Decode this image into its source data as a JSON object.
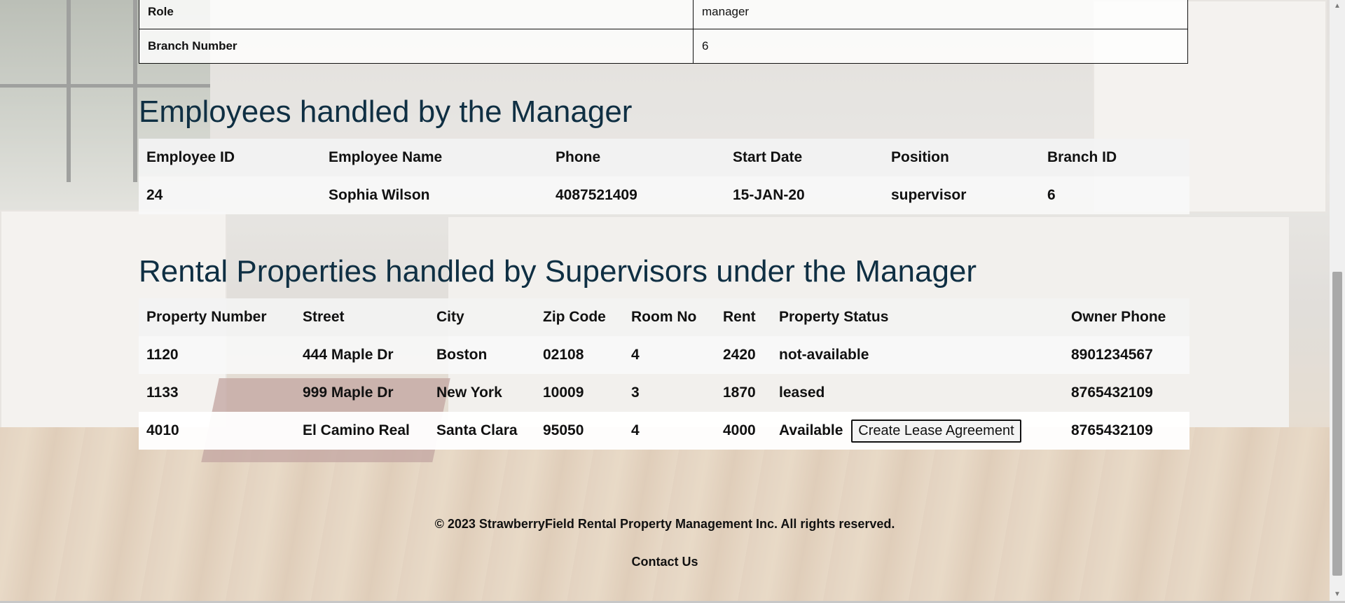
{
  "details": {
    "rows": [
      {
        "label": "Role",
        "value": "manager"
      },
      {
        "label": "Branch Number",
        "value": "6"
      }
    ]
  },
  "employees": {
    "heading": "Employees handled by the Manager",
    "columns": [
      "Employee ID",
      "Employee Name",
      "Phone",
      "Start Date",
      "Position",
      "Branch ID"
    ],
    "rows": [
      [
        "24",
        "Sophia Wilson",
        "4087521409",
        "15-JAN-20",
        "supervisor",
        "6"
      ]
    ]
  },
  "rentals": {
    "heading": "Rental Properties handled by Supervisors under the Manager",
    "columns": [
      "Property Number",
      "Street",
      "City",
      "Zip Code",
      "Room No",
      "Rent",
      "Property Status",
      "Owner Phone"
    ],
    "rows": [
      [
        "1120",
        "444 Maple Dr",
        "Boston",
        "02108",
        "4",
        "2420",
        "not-available",
        "8901234567"
      ],
      [
        "1133",
        "999 Maple Dr",
        "New York",
        "10009",
        "3",
        "1870",
        "leased",
        "8765432109"
      ],
      [
        "4010",
        "El Camino Real",
        "Santa Clara",
        "95050",
        "4",
        "4000",
        "Available",
        "8765432109"
      ]
    ],
    "lease_button_label": "Create Lease Agreement"
  },
  "footer": {
    "copyright": "© 2023 StrawberryField Rental Property Management Inc. All rights reserved.",
    "contact": "Contact Us"
  }
}
